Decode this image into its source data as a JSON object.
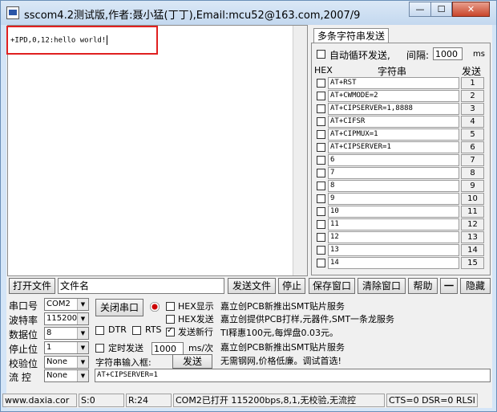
{
  "window": {
    "title": "sscom4.2测试版,作者:聂小猛(丁丁),Email:mcu52@163.com,2007/9",
    "min_label": "—",
    "max_label": "☐",
    "close_label": "✕"
  },
  "receive": {
    "text": "+IPD,0,12:hello world!"
  },
  "multi": {
    "tab_label": "多条字符串发送",
    "auto_loop_label": "自动循环发送,",
    "interval_label": "间隔:",
    "interval_value": "1000",
    "interval_unit": "ms",
    "col_hex": "HEX",
    "col_string": "字符串",
    "col_send": "发送",
    "rows": [
      {
        "cmd": "AT+RST",
        "num": "1"
      },
      {
        "cmd": "AT+CWMODE=2",
        "num": "2"
      },
      {
        "cmd": "AT+CIPSERVER=1,8888",
        "num": "3"
      },
      {
        "cmd": "AT+CIFSR",
        "num": "4"
      },
      {
        "cmd": "AT+CIPMUX=1",
        "num": "5"
      },
      {
        "cmd": "AT+CIPSERVER=1",
        "num": "6"
      },
      {
        "cmd": "6",
        "num": "7"
      },
      {
        "cmd": "7",
        "num": "8"
      },
      {
        "cmd": "8",
        "num": "9"
      },
      {
        "cmd": "9",
        "num": "10"
      },
      {
        "cmd": "10",
        "num": "11"
      },
      {
        "cmd": "11",
        "num": "12"
      },
      {
        "cmd": "12",
        "num": "13"
      },
      {
        "cmd": "13",
        "num": "14"
      },
      {
        "cmd": "14",
        "num": "15"
      }
    ]
  },
  "toolbar": {
    "open_file": "打开文件",
    "file_name": "文件名",
    "send_file": "发送文件",
    "stop": "停止",
    "save_window": "保存窗口",
    "clear_window": "清除窗口",
    "help": "帮助",
    "dash": "一",
    "hide": "隐藏"
  },
  "settings": {
    "port_label": "串口号",
    "port_value": "COM2",
    "baud_label": "波特率",
    "baud_value": "115200",
    "data_label": "数据位",
    "data_value": "8",
    "stop_label": "停止位",
    "stop_value": "1",
    "parity_label": "校验位",
    "parity_value": "None",
    "flow_label": "流 控",
    "flow_value": "None",
    "close_port": "关闭串口",
    "hex_display": "HEX显示",
    "hex_send": "HEX发送",
    "send_newline": "发送新行",
    "dtr": "DTR",
    "rts": "RTS",
    "timed_send": "定时发送",
    "timed_value": "1000",
    "timed_unit": "ms/次",
    "input_label": "字符串输入框:",
    "send_button": "发送",
    "input_value": "AT+CIPSERVER=1"
  },
  "ad": {
    "line1": "嘉立创PCB新推出SMT贴片服务",
    "line2": "嘉立创提供PCB打样,元器件,SMT一条龙服务",
    "line3": "TI释惠100元,每焊盘0.03元。",
    "line4": "嘉立创PCB新推出SMT贴片服务",
    "line5": "无需钢网,价格低廉。调试首选!"
  },
  "status": {
    "site": "www.daxia.cor",
    "s": "S:0",
    "r": "R:24",
    "port_info": "COM2已打开  115200bps,8,1,无校验,无流控",
    "lines": "CTS=0 DSR=0 RLSI"
  }
}
